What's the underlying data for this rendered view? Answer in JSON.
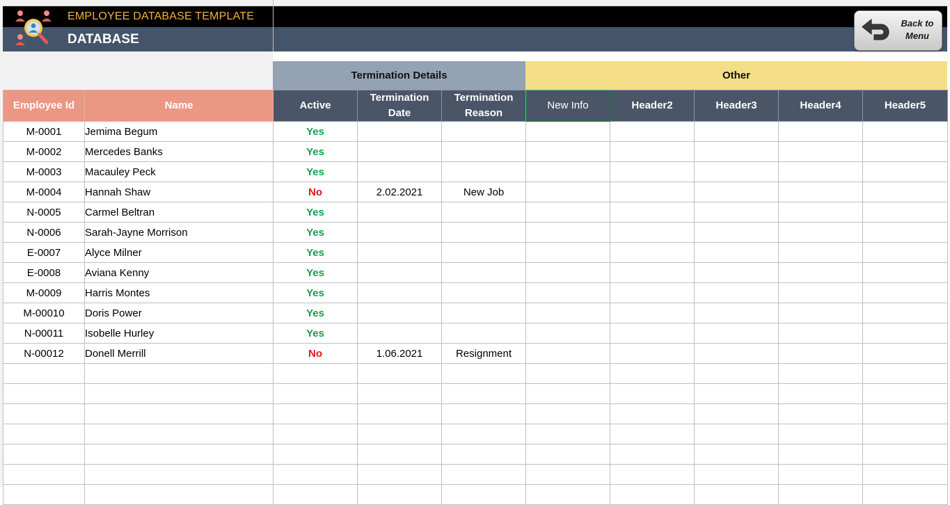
{
  "header": {
    "title": "EMPLOYEE DATABASE TEMPLATE",
    "subtitle": "DATABASE",
    "back_button": "Back to Menu",
    "logo_icon": "people-search-icon",
    "back_icon": "return-arrow-icon"
  },
  "groups": {
    "termination": "Termination Details",
    "other": "Other"
  },
  "columns": [
    "Employee Id",
    "Name",
    "Active",
    "Termination Date",
    "Termination Reason",
    "New Info",
    "Header2",
    "Header3",
    "Header4",
    "Header5"
  ],
  "rows": [
    {
      "id": "M-0001",
      "name": "Jemima Begum",
      "active": "Yes",
      "term_date": "",
      "term_reason": ""
    },
    {
      "id": "M-0002",
      "name": "Mercedes Banks",
      "active": "Yes",
      "term_date": "",
      "term_reason": ""
    },
    {
      "id": "M-0003",
      "name": "Macauley Peck",
      "active": "Yes",
      "term_date": "",
      "term_reason": ""
    },
    {
      "id": "M-0004",
      "name": "Hannah Shaw",
      "active": "No",
      "term_date": "2.02.2021",
      "term_reason": "New Job"
    },
    {
      "id": "N-0005",
      "name": "Carmel Beltran",
      "active": "Yes",
      "term_date": "",
      "term_reason": ""
    },
    {
      "id": "N-0006",
      "name": "Sarah-Jayne Morrison",
      "active": "Yes",
      "term_date": "",
      "term_reason": ""
    },
    {
      "id": "E-0007",
      "name": "Alyce Milner",
      "active": "Yes",
      "term_date": "",
      "term_reason": ""
    },
    {
      "id": "E-0008",
      "name": "Aviana Kenny",
      "active": "Yes",
      "term_date": "",
      "term_reason": ""
    },
    {
      "id": "M-0009",
      "name": "Harris Montes",
      "active": "Yes",
      "term_date": "",
      "term_reason": ""
    },
    {
      "id": "M-00010",
      "name": "Doris Power",
      "active": "Yes",
      "term_date": "",
      "term_reason": ""
    },
    {
      "id": "N-00011",
      "name": "Isobelle Hurley",
      "active": "Yes",
      "term_date": "",
      "term_reason": ""
    },
    {
      "id": "N-00012",
      "name": "Donell Merrill",
      "active": "No",
      "term_date": "1.06.2021",
      "term_reason": "Resignment"
    }
  ],
  "colors": {
    "title": "#f4b13a",
    "slate": "#44546a",
    "header_dark": "#4a5568",
    "header_salmon": "#ec9684",
    "group_termination": "#94a3b3",
    "group_other": "#f3dd86",
    "yes": "#14a14a",
    "no": "#e0141b"
  }
}
